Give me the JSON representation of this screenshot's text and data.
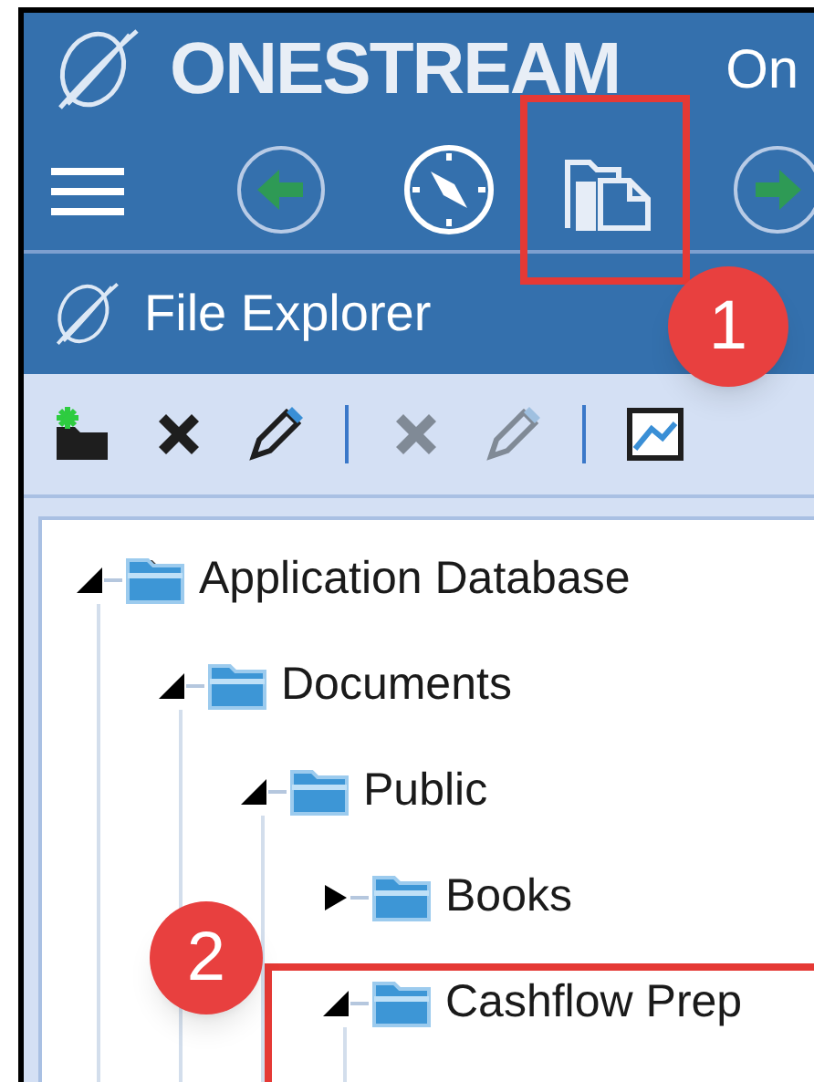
{
  "header": {
    "logo_text": "ONESTREAM",
    "title": "On"
  },
  "panel": {
    "title": "File Explorer"
  },
  "toolbar": [
    {
      "kind": "new-folder",
      "disabled": false
    },
    {
      "kind": "delete",
      "disabled": false
    },
    {
      "kind": "edit",
      "disabled": false
    },
    {
      "kind": "separator"
    },
    {
      "kind": "delete",
      "disabled": true
    },
    {
      "kind": "edit",
      "disabled": true
    },
    {
      "kind": "separator"
    },
    {
      "kind": "image",
      "disabled": false
    }
  ],
  "tree": [
    {
      "label": "Application Database",
      "expanded": true,
      "children": [
        {
          "label": "Documents",
          "expanded": true,
          "children": [
            {
              "label": "Public",
              "expanded": true,
              "children": [
                {
                  "label": "Books",
                  "expanded": false
                },
                {
                  "label": "Cashflow Prep",
                  "expanded": true
                }
              ]
            }
          ]
        }
      ]
    }
  ],
  "annotations": [
    {
      "label": "1"
    },
    {
      "label": "2"
    }
  ]
}
